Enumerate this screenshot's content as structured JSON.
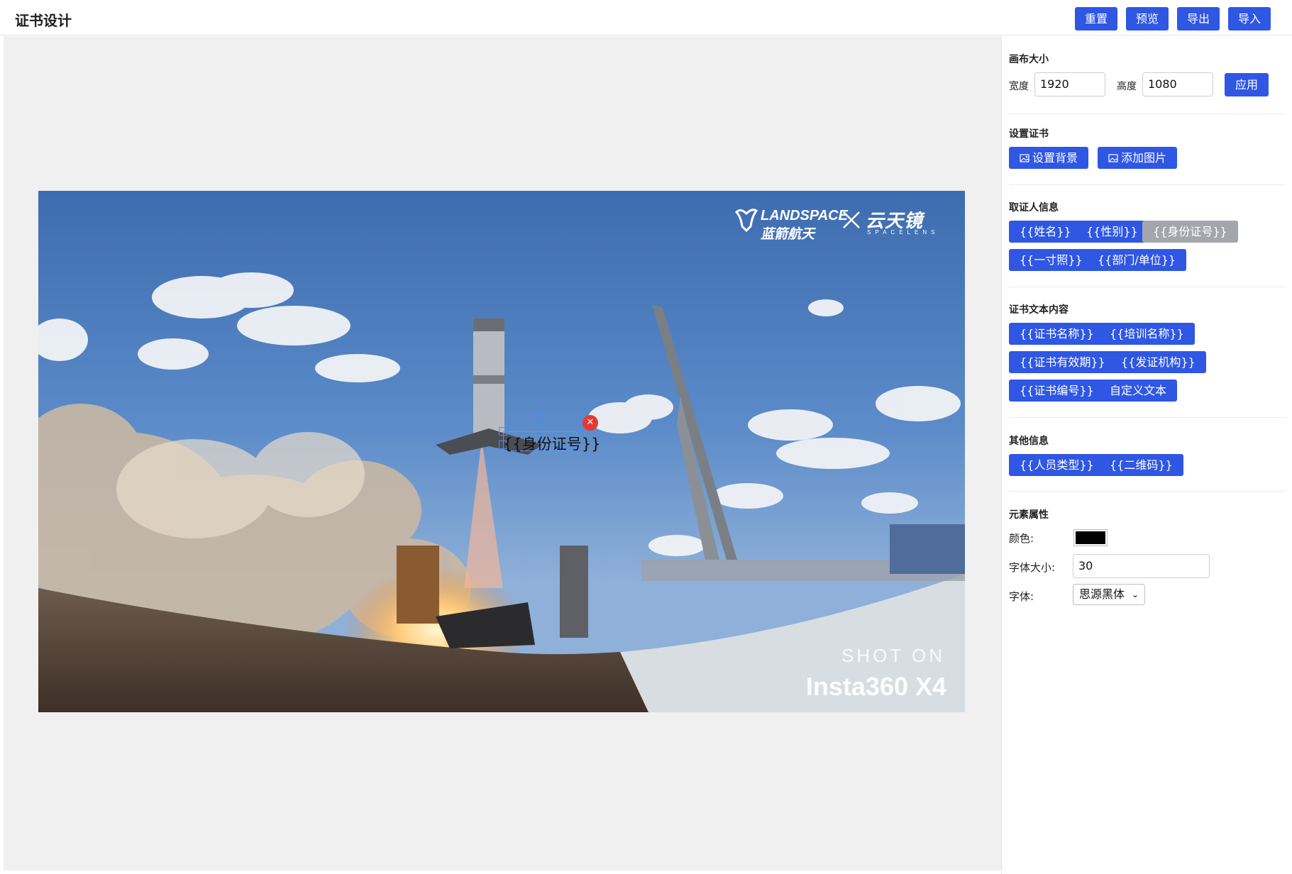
{
  "header": {
    "title": "证书设计",
    "buttons": [
      "重置",
      "预览",
      "导出",
      "导入"
    ]
  },
  "canvas_preview": {
    "selected_element_text": "{{身份证号}}",
    "logo_landspace_en": "LANDSPACE",
    "logo_landspace_cn": "蓝箭航天",
    "logo_spacelens_cn": "云天镜",
    "logo_spacelens_en": "SPACELENS",
    "watermark_line1": "SHOT ON",
    "watermark_line2": "Insta360 X4"
  },
  "panel": {
    "canvas_size": {
      "title": "画布大小",
      "width_label": "宽度",
      "width_value": "1920",
      "height_label": "高度",
      "height_value": "1080",
      "apply_label": "应用"
    },
    "cert_settings": {
      "title": "设置证书",
      "set_background": "设置背景",
      "add_image": "添加图片"
    },
    "holder_info": {
      "title": "取证人信息",
      "items": [
        "{{姓名}}",
        "{{性别}}",
        "{{身份证号}}",
        "{{一寸照}}",
        "{{部门/单位}}"
      ]
    },
    "cert_text": {
      "title": "证书文本内容",
      "items": [
        "{{证书名称}}",
        "{{培训名称}}",
        "{{证书有效期}}",
        "{{发证机构}}",
        "{{证书编号}}",
        "自定义文本"
      ]
    },
    "other_info": {
      "title": "其他信息",
      "items": [
        "{{人员类型}}",
        "{{二维码}}"
      ]
    },
    "element_props": {
      "title": "元素属性",
      "color_label": "颜色:",
      "color_value": "#000000",
      "font_size_label": "字体大小:",
      "font_size_value": "30",
      "font_label": "字体:",
      "font_value": "思源黑体"
    }
  },
  "colors": {
    "primary": "#2f57e4",
    "disabled": "#a3a6ad",
    "canvas_bg": "#f0f0f0"
  }
}
